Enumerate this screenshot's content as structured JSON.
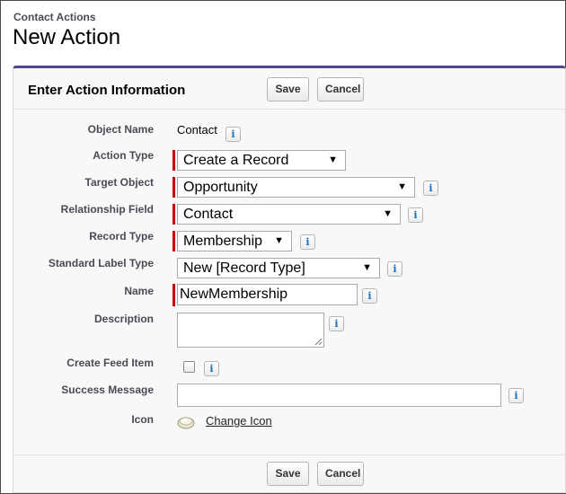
{
  "header": {
    "breadcrumb": "Contact Actions",
    "title": "New Action"
  },
  "panel": {
    "title": "Enter Action Information",
    "save_label": "Save",
    "cancel_label": "Cancel"
  },
  "fields": {
    "object_name": {
      "label": "Object Name",
      "value": "Contact"
    },
    "action_type": {
      "label": "Action Type",
      "value": "Create a Record"
    },
    "target_object": {
      "label": "Target Object",
      "value": "Opportunity"
    },
    "relationship_field": {
      "label": "Relationship Field",
      "value": "Contact"
    },
    "record_type": {
      "label": "Record Type",
      "value": "Membership"
    },
    "standard_label_type": {
      "label": "Standard Label Type",
      "value": "New [Record Type]"
    },
    "name": {
      "label": "Name",
      "value": "NewMembership"
    },
    "description": {
      "label": "Description",
      "value": ""
    },
    "create_feed_item": {
      "label": "Create Feed Item",
      "checked": false
    },
    "success_message": {
      "label": "Success Message",
      "value": ""
    },
    "icon": {
      "label": "Icon",
      "link": "Change Icon"
    }
  },
  "info_glyph": "i",
  "dropdown_glyph": "▼",
  "colors": {
    "panel_accent": "#56458c",
    "required_bar": "#cc0000",
    "info_icon": "#1f6fb8"
  }
}
